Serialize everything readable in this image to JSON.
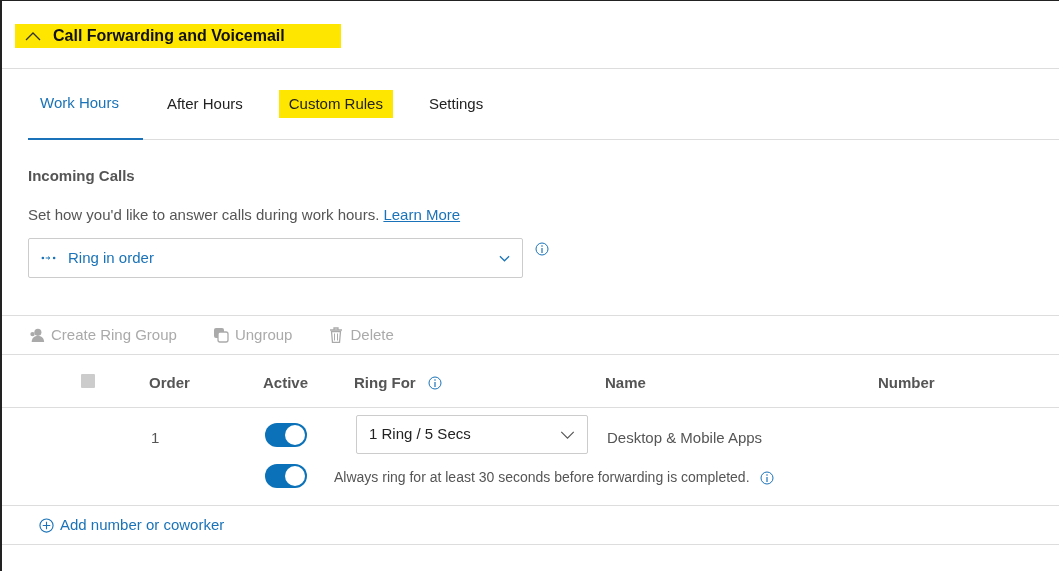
{
  "section": {
    "title": "Call Forwarding and Voicemail",
    "expanded": true,
    "highlighted": true
  },
  "tabs": [
    {
      "label": "Work Hours",
      "selected": true,
      "highlighted": false
    },
    {
      "label": "After Hours",
      "selected": false,
      "highlighted": false
    },
    {
      "label": "Custom Rules",
      "selected": false,
      "highlighted": true
    },
    {
      "label": "Settings",
      "selected": false,
      "highlighted": false
    }
  ],
  "incoming": {
    "heading": "Incoming Calls",
    "description": "Set how you'd like to answer calls during work hours.",
    "link": "Learn More",
    "dropdown": {
      "value": "Ring in order"
    }
  },
  "toolbar": [
    {
      "kind": "person",
      "label": "Create Ring Group",
      "disabled": true
    },
    {
      "kind": "ungroup",
      "label": "Ungroup",
      "disabled": true
    },
    {
      "kind": "trash",
      "label": "Delete",
      "disabled": true
    }
  ],
  "table": {
    "select_all": {
      "disabled": true
    },
    "columns": [
      {
        "label": "Order",
        "kind": "plain"
      },
      {
        "label": "Active",
        "kind": "plain"
      },
      {
        "label": "Ring For",
        "kind": "info"
      },
      {
        "label": "Name",
        "kind": "plain"
      },
      {
        "label": "Number",
        "kind": "plain"
      }
    ],
    "rows": [
      {
        "order": "1",
        "active": true,
        "ring_for": "1 Ring / 5 Secs",
        "name": "Desktop & Mobile Apps"
      }
    ],
    "always_ring": {
      "on": true,
      "text": "Always ring for at least 30 seconds before forwarding is completed."
    }
  },
  "add_link": "Add number or coworker"
}
